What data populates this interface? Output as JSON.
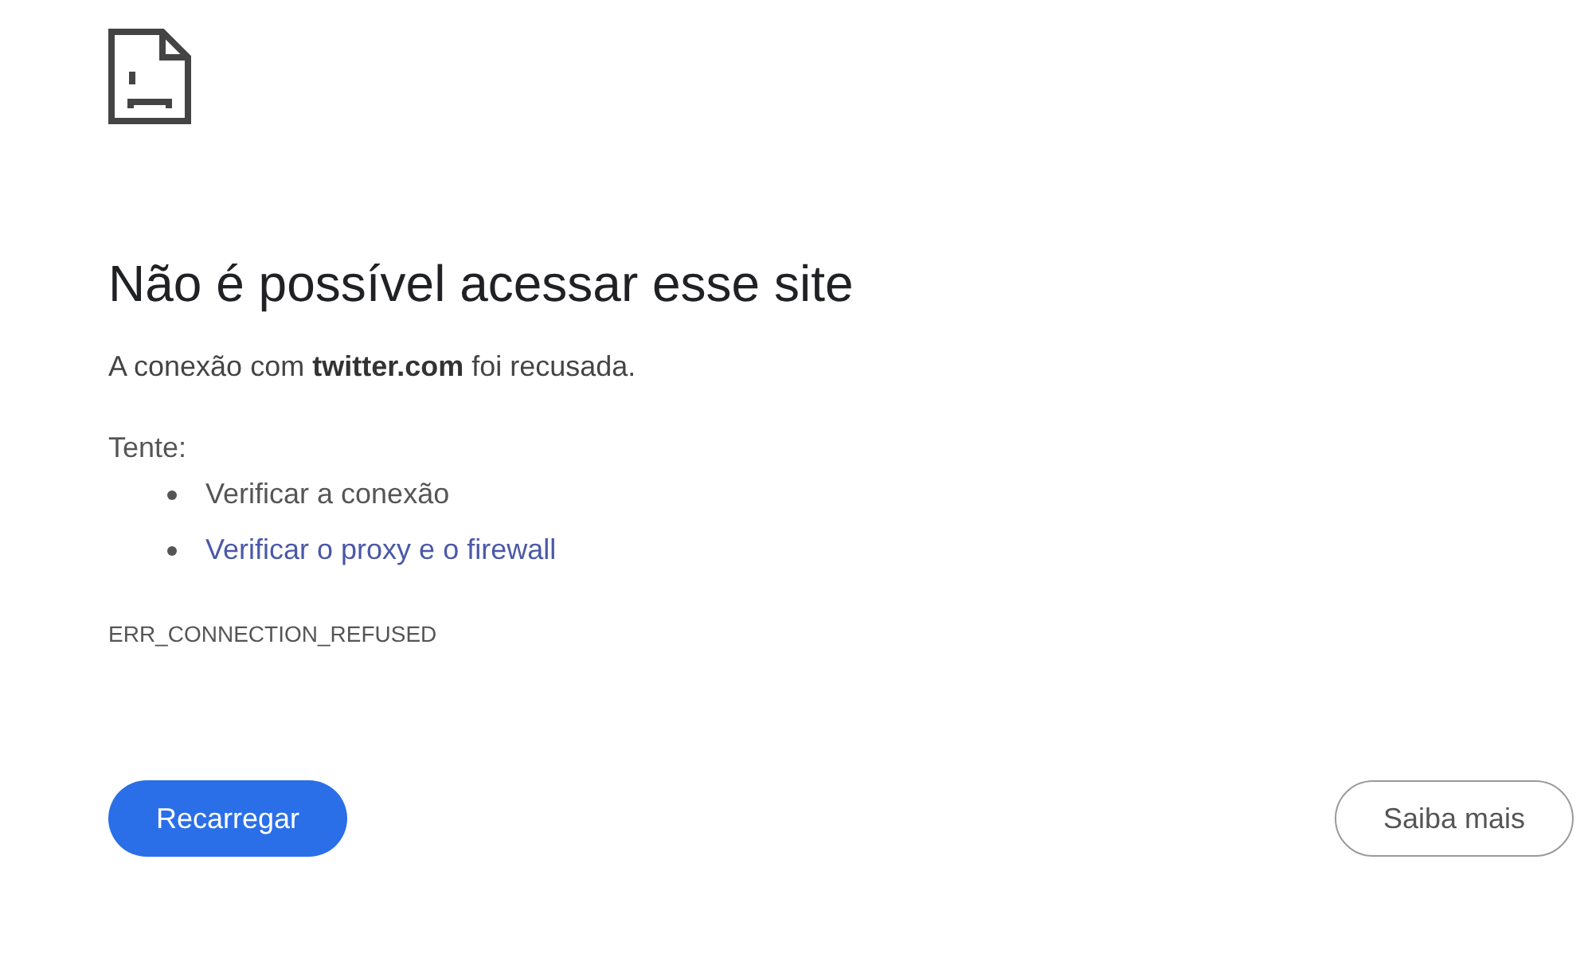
{
  "heading": "Não é possível acessar esse site",
  "message": "A conexão com **twitter.com** foi recusada.",
  "suggestions_label": "Tente:",
  "suggestions": [
    {
      "kind": "text",
      "label": "Verificar a conexão"
    },
    {
      "kind": "link",
      "label": "Verificar o proxy e o firewall"
    }
  ],
  "error_code": "ERR_CONNECTION_REFUSED",
  "buttons": [
    {
      "kind": "primary",
      "label": "Recarregar"
    },
    {
      "kind": "secondary",
      "label": "Saiba mais"
    }
  ]
}
